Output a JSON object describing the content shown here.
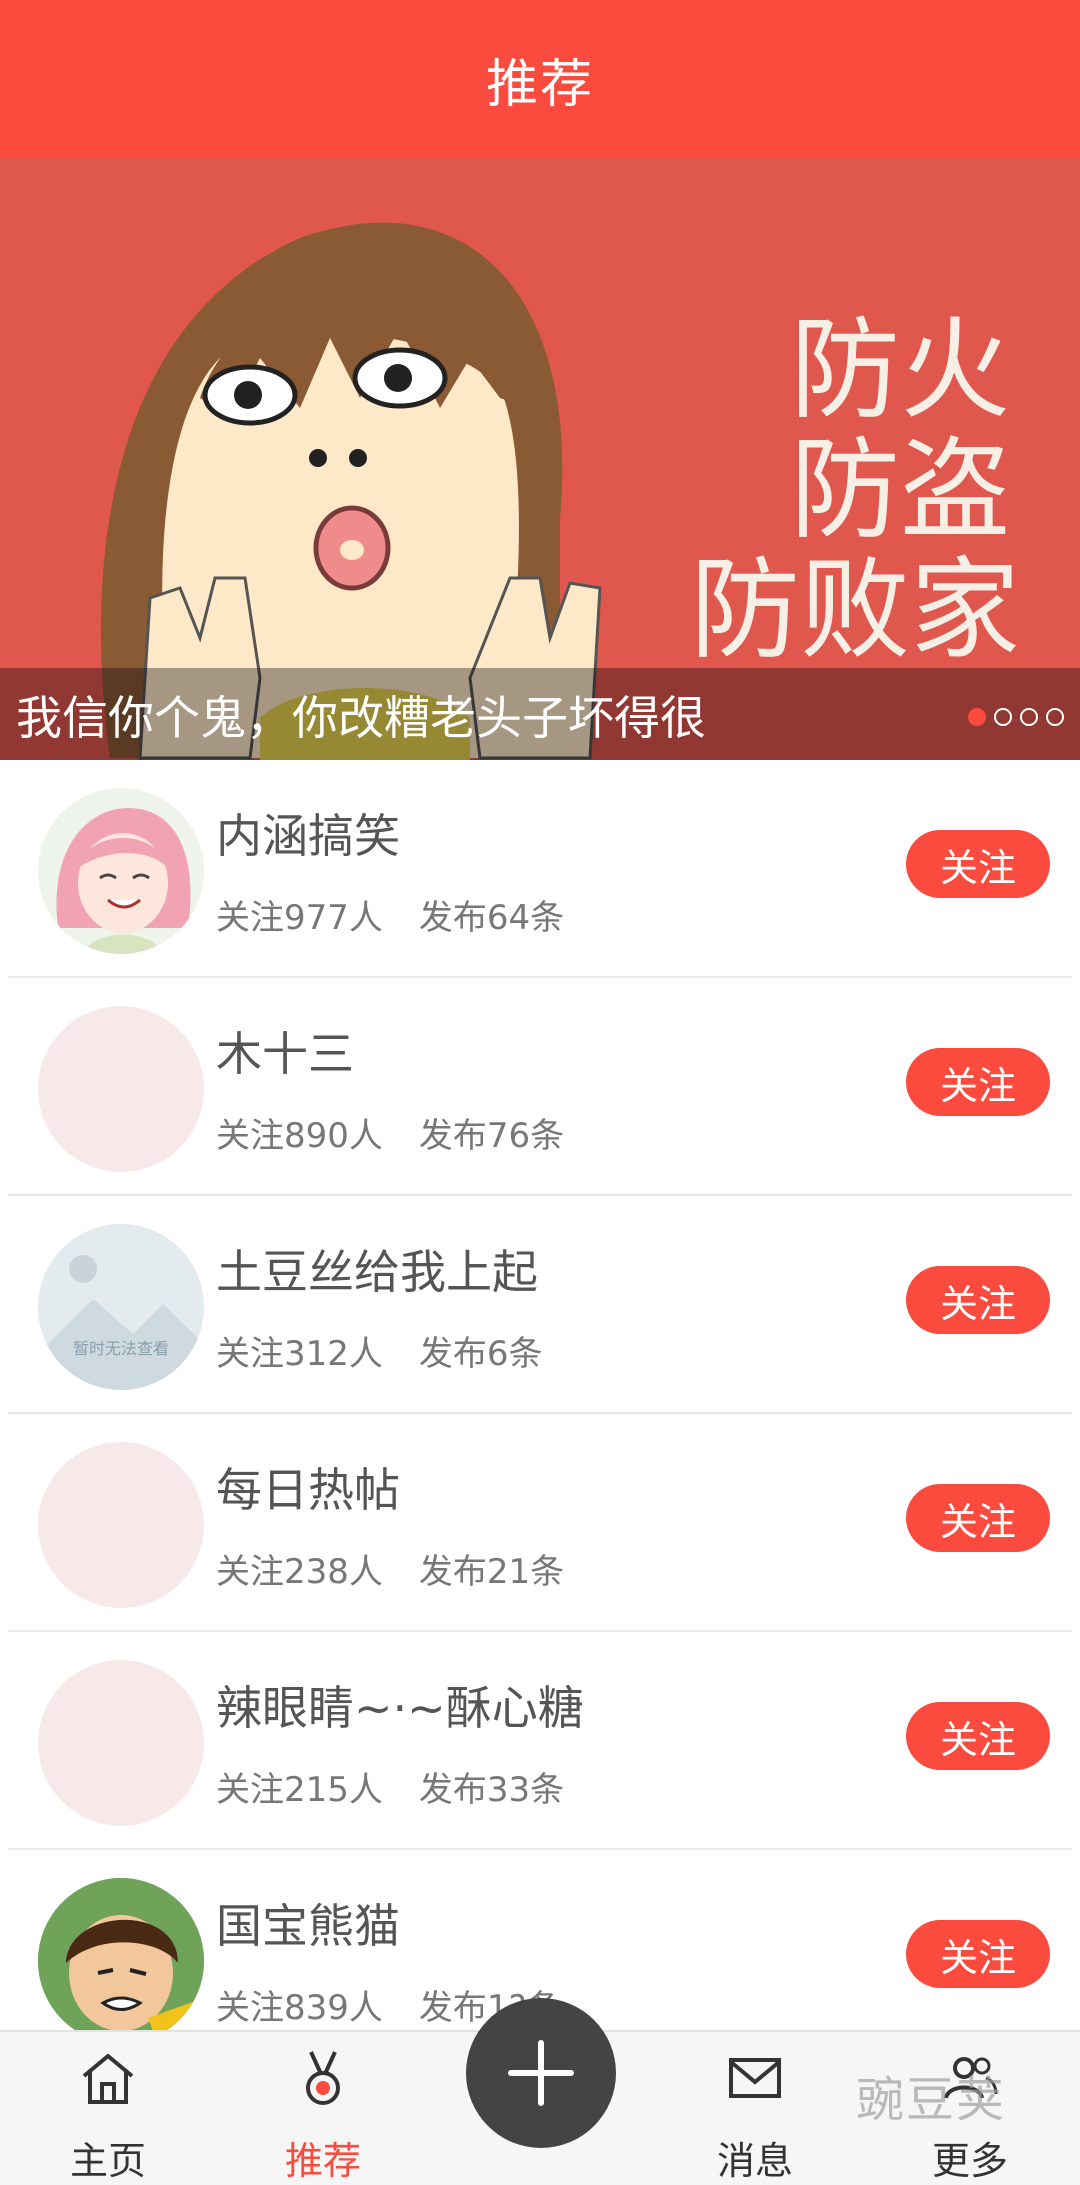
{
  "header": {
    "title": "推荐"
  },
  "banner": {
    "caption": "我信你个鬼，你改糟老头子坏得很",
    "poster_lines": [
      "防火",
      "防盗",
      "防败家"
    ],
    "dots_count": 4,
    "active_dot": 0
  },
  "list": [
    {
      "name": "内涵搞笑",
      "followers": "关注977人",
      "posts": "发布64条",
      "button": "关注",
      "avatar": "pink-anime-girl"
    },
    {
      "name": "木十三",
      "followers": "关注890人",
      "posts": "发布76条",
      "button": "关注",
      "avatar": "placeholder"
    },
    {
      "name": "土豆丝给我上起",
      "followers": "关注312人",
      "posts": "发布6条",
      "button": "关注",
      "avatar": "unavailable",
      "avatar_text": "暂时无法查看"
    },
    {
      "name": "每日热帖",
      "followers": "关注238人",
      "posts": "发布21条",
      "button": "关注",
      "avatar": "placeholder"
    },
    {
      "name": "辣眼睛~·~酥心糖",
      "followers": "关注215人",
      "posts": "发布33条",
      "button": "关注",
      "avatar": "placeholder"
    },
    {
      "name": "国宝熊猫",
      "followers": "关注839人",
      "posts": "发布1?条",
      "button": "关注",
      "avatar": "cartoon-boy"
    }
  ],
  "bottom_nav": {
    "items": [
      {
        "label": "主页",
        "icon": "home-icon"
      },
      {
        "label": "推荐",
        "icon": "medal-icon"
      },
      {
        "label": "消息",
        "icon": "mail-icon"
      },
      {
        "label": "更多",
        "icon": "users-icon"
      }
    ],
    "fab_icon": "plus-icon"
  },
  "watermark": "豌豆荚",
  "colors": {
    "accent": "#fb4a3e",
    "fab": "#444444"
  }
}
